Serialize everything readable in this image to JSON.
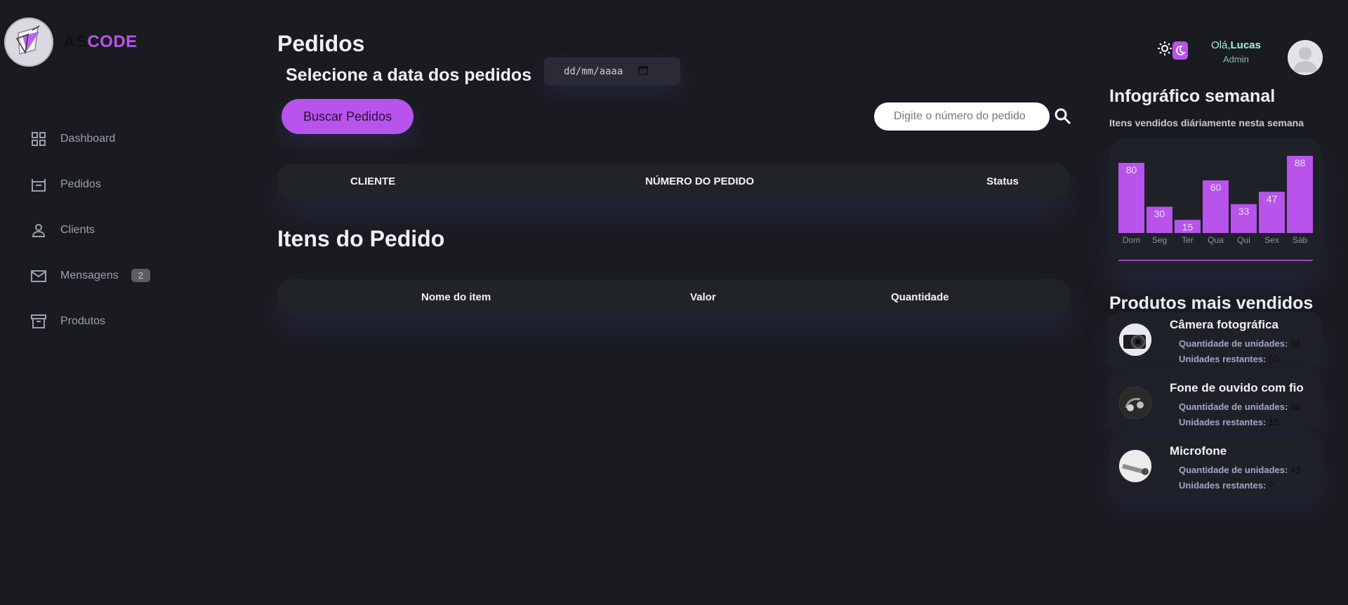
{
  "brand": {
    "part1": "AS",
    "part2": "CODE"
  },
  "sidebar": {
    "items": [
      {
        "label": "Dashboard",
        "icon": "grid-icon"
      },
      {
        "label": "Pedidos",
        "icon": "basket-icon"
      },
      {
        "label": "Clients",
        "icon": "user-icon"
      },
      {
        "label": "Mensagens",
        "icon": "mail-icon",
        "badge": "2"
      },
      {
        "label": "Produtos",
        "icon": "archive-icon"
      }
    ]
  },
  "main": {
    "title": "Pedidos",
    "date_label": "Selecione a data dos pedidos",
    "date_placeholder": "dd/mm/aaaa",
    "search_button": "Buscar Pedidos",
    "search_placeholder": "Digite o número do pedido",
    "orders_table": {
      "headers": [
        "CLIENTE",
        "NÚMERO DO PEDIDO",
        "Status"
      ]
    },
    "items_title": "Itens do Pedido",
    "items_table": {
      "headers": [
        "Nome do item",
        "Valor",
        "Quantidade"
      ]
    }
  },
  "header": {
    "greeting": "Olá,",
    "user_name": "Lucas",
    "role": "Admin"
  },
  "weekly": {
    "title": "Infográfico semanal",
    "subtitle": "Itens vendidos diáriamente nesta semana"
  },
  "chart_data": {
    "type": "bar",
    "categories": [
      "Dom",
      "Seg",
      "Ter",
      "Qua",
      "Qui",
      "Sex",
      "Sáb"
    ],
    "values": [
      80,
      30,
      15,
      60,
      33,
      47,
      88
    ],
    "ylim": [
      0,
      88
    ],
    "bar_color": "#b853ec",
    "grid": false,
    "data_labels": true
  },
  "top_products": {
    "title": "Produtos mais vendidos",
    "qty_label": "Quantidade de unidades:",
    "rem_label": "Unidades restantes:",
    "items": [
      {
        "name": "Câmera fotográfica",
        "qty": "93",
        "remaining": "50"
      },
      {
        "name": "Fone de ouvido com fio",
        "qty": "60",
        "remaining": "15"
      },
      {
        "name": "Microfone",
        "qty": "43",
        "remaining": "7"
      }
    ]
  },
  "colors": {
    "accent": "#b853ec",
    "bg": "#1a1b20",
    "card": "#212427"
  }
}
